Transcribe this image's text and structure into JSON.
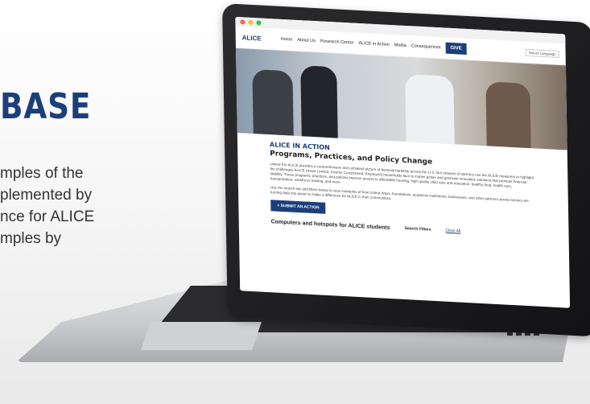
{
  "promo": {
    "title": "BASE",
    "lines": [
      "mples of the",
      "plemented by",
      "nce for ALICE",
      "mples by"
    ]
  },
  "site": {
    "logo": "ALICE",
    "nav": [
      "Home",
      "About Us",
      "Research Center",
      "ALICE in Action",
      "Media",
      "Consequences"
    ],
    "give_label": "GIVE",
    "language": "Select Language",
    "eyebrow": "ALICE IN ACTION",
    "headline": "Programs, Practices, and Policy Change",
    "para1": "United For ALICE provides a comprehensive and unbiased picture of financial hardship across the U.S. Our network of partners use the ALICE measures to highlight the challenges ALICE (Asset Limited, Income Constrained, Employed) households face to inspire action and generate innovative solutions that promote financial stability. These programs, practices, and policies improve access to affordable housing, high quality child care and education, healthy food, health care, transportation, workforce training, and more.",
    "para2": "Use the search bar and filters below to view examples of how United Ways, foundations, academic institutions, businesses, and other partners across sectors are turning data into action to make a difference for ALICE in their communities.",
    "submit_label": "+ SUBMIT AN ACTION",
    "subhead": "Computers and hotspots for ALICE students",
    "filters_label": "Search Filters",
    "clear_label": "Clear All"
  },
  "colors": {
    "brand": "#1c3f7a"
  }
}
